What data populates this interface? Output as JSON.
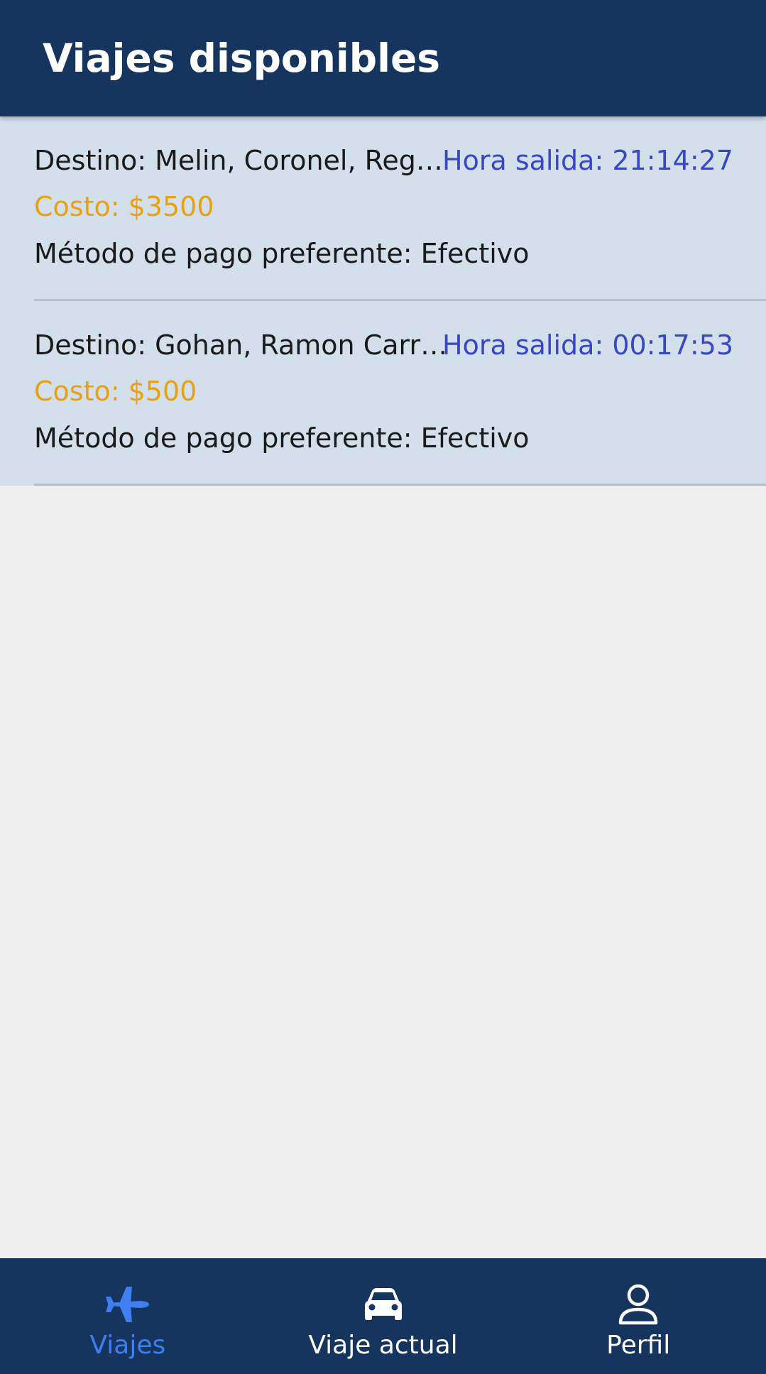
{
  "app_bar": {
    "title": "Viajes disponibles"
  },
  "trips": [
    {
      "destination": "Destino: Melin, Coronel, Región del Biobío",
      "departure": "Hora salida: 21:14:27",
      "cost": "Costo: $3500",
      "payment": "Método de pago preferente: Efectivo"
    },
    {
      "destination": "Destino: Gohan, Ramon Carrasco",
      "departure": "Hora salida: 00:17:53",
      "cost": "Costo: $500",
      "payment": "Método de pago preferente: Efectivo"
    }
  ],
  "bottom_nav": {
    "items": [
      {
        "label": "Viajes",
        "icon": "airplane-icon",
        "active": true
      },
      {
        "label": "Viaje actual",
        "icon": "car-icon",
        "active": false
      },
      {
        "label": "Perfil",
        "icon": "person-icon",
        "active": false
      }
    ]
  },
  "colors": {
    "app_bar_bg": "#15355f",
    "list_bg": "#d4dfec",
    "departure_text": "#3847c4",
    "cost_text": "#e8a112",
    "nav_active": "#3d7ff0",
    "nav_inactive": "#ffffff"
  }
}
